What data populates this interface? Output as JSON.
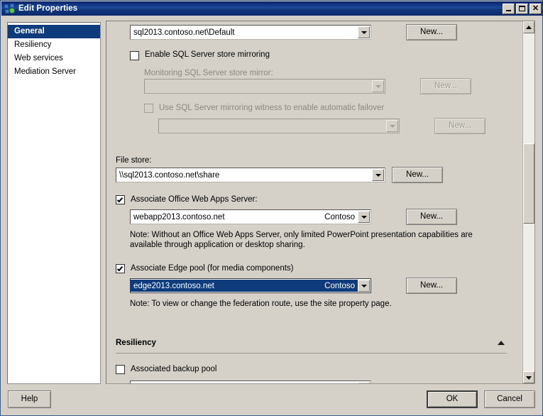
{
  "window": {
    "title": "Edit Properties",
    "icon": "edit-properties-icon",
    "minimize_label": "Minimize",
    "maximize_label": "Maximize",
    "close_label": "Close"
  },
  "sidebar": {
    "items": [
      {
        "label": "General",
        "selected": true
      },
      {
        "label": "Resiliency",
        "selected": false
      },
      {
        "label": "Web services",
        "selected": false
      },
      {
        "label": "Mediation Server",
        "selected": false
      }
    ]
  },
  "general": {
    "sql_store": {
      "value": "sql2013.contoso.net\\Default",
      "new_button": "New..."
    },
    "enable_mirroring": {
      "label": "Enable SQL Server store mirroring",
      "checked": false
    },
    "monitoring_mirror": {
      "label": "Monitoring SQL Server store mirror:",
      "value": "",
      "new_button": "New...",
      "disabled": true
    },
    "mirroring_witness": {
      "label": "Use SQL Server mirroring witness to enable automatic failover",
      "checked": false,
      "disabled": true,
      "value": "",
      "new_button": "New..."
    },
    "file_store": {
      "label": "File store:",
      "value": "\\\\sql2013.contoso.net\\share",
      "new_button": "New..."
    },
    "office_web_apps": {
      "label": "Associate Office Web Apps Server:",
      "checked": true,
      "value": "webapp2013.contoso.net",
      "suffix": "Contoso",
      "new_button": "New...",
      "note": "Note: Without an Office Web Apps Server, only limited PowerPoint presentation capabilities are available through application or desktop sharing."
    },
    "edge_pool": {
      "label": "Associate Edge pool (for media components)",
      "checked": true,
      "value": "edge2013.contoso.net",
      "suffix": "Contoso",
      "selected": true,
      "new_button": "New...",
      "note": "Note: To view or change the federation route, use the site property page."
    }
  },
  "resiliency": {
    "heading": "Resiliency",
    "collapse_icon": "chevron-up-icon",
    "backup_pool": {
      "label": "Associated backup pool",
      "checked": false,
      "value": ""
    }
  },
  "scrollbar": {
    "up_icon": "scroll-up-arrow-icon",
    "down_icon": "scroll-down-arrow-icon",
    "thumb_label": "vertical-scroll-thumb"
  },
  "footer": {
    "help": "Help",
    "ok": "OK",
    "cancel": "Cancel"
  },
  "colors": {
    "accent": "#0e3b7c",
    "window_bg": "#d5d1c9",
    "title_bg": "#0a246a",
    "field_bg": "#ffffff",
    "disabled_text": "#8b8882"
  }
}
